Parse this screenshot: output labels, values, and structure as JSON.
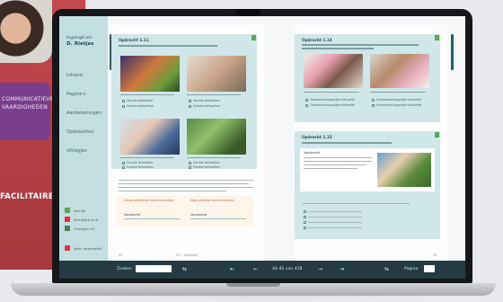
{
  "backdrop": {
    "card_lines": [
      "COMMUNICATIEVE",
      "VAARDIGHEDEN"
    ],
    "label": "FACILITAIRE"
  },
  "sidebar": {
    "login_label": "Ingelogd als:",
    "user_name": "D. Rietjes",
    "items": [
      {
        "label": "Inhoud"
      },
      {
        "label": "Pagina's"
      },
      {
        "label": "Aantekeningen"
      },
      {
        "label": "Opdrachten"
      },
      {
        "label": "Uitlegjes"
      }
    ],
    "legend": [
      {
        "label": "Verrijkt",
        "color": "#5aa65a"
      },
      {
        "label": "Verrijking kind",
        "color": "#d8383e"
      },
      {
        "label": "Overigen k3",
        "color": "#4c7e56"
      }
    ],
    "info_label": "Meer informatie?"
  },
  "left_page": {
    "task1_title": "Opdracht 1.11",
    "task_number": "1",
    "check_labels": [
      "Sociale behoeften",
      "Fysieke behoeften",
      "Sociale behoeften",
      "Fysieke behoeften",
      "Sociale behoeften",
      "Fysieke behoeften",
      "Sociale behoeften",
      "Fysieke behoeften"
    ],
    "col_head_1": "Gesocialiseerde communicatie",
    "col_head_2": "Non-verbale communicatie",
    "voorbeeld_1": "Voorbeeld",
    "voorbeeld_2": "Voorbeeld",
    "page_no_left": "24",
    "footer_text": "ICT · Facilitair"
  },
  "right_page": {
    "task2_title": "Opdracht 1.14",
    "task3_title": "Opdracht 1.15",
    "voorbeeld": "Voorbeeld",
    "check_labels": [
      "Gemeenschappelijke behoefte",
      "Gemeenschappelijke behoefte",
      "Gemeenschappelijke behoefte",
      "Gemeenschappelijke behoefte"
    ],
    "page_no_right": "25"
  },
  "toolbar": {
    "zoom_label": "Zoeken",
    "page_info": "44-45 van 428",
    "page_label": "Pagina"
  },
  "colors": {
    "teal_panel": "#cfe7e9",
    "sidebar": "#c4dfe2",
    "toolbar": "#243b43",
    "accent_green": "#5aa65a"
  }
}
